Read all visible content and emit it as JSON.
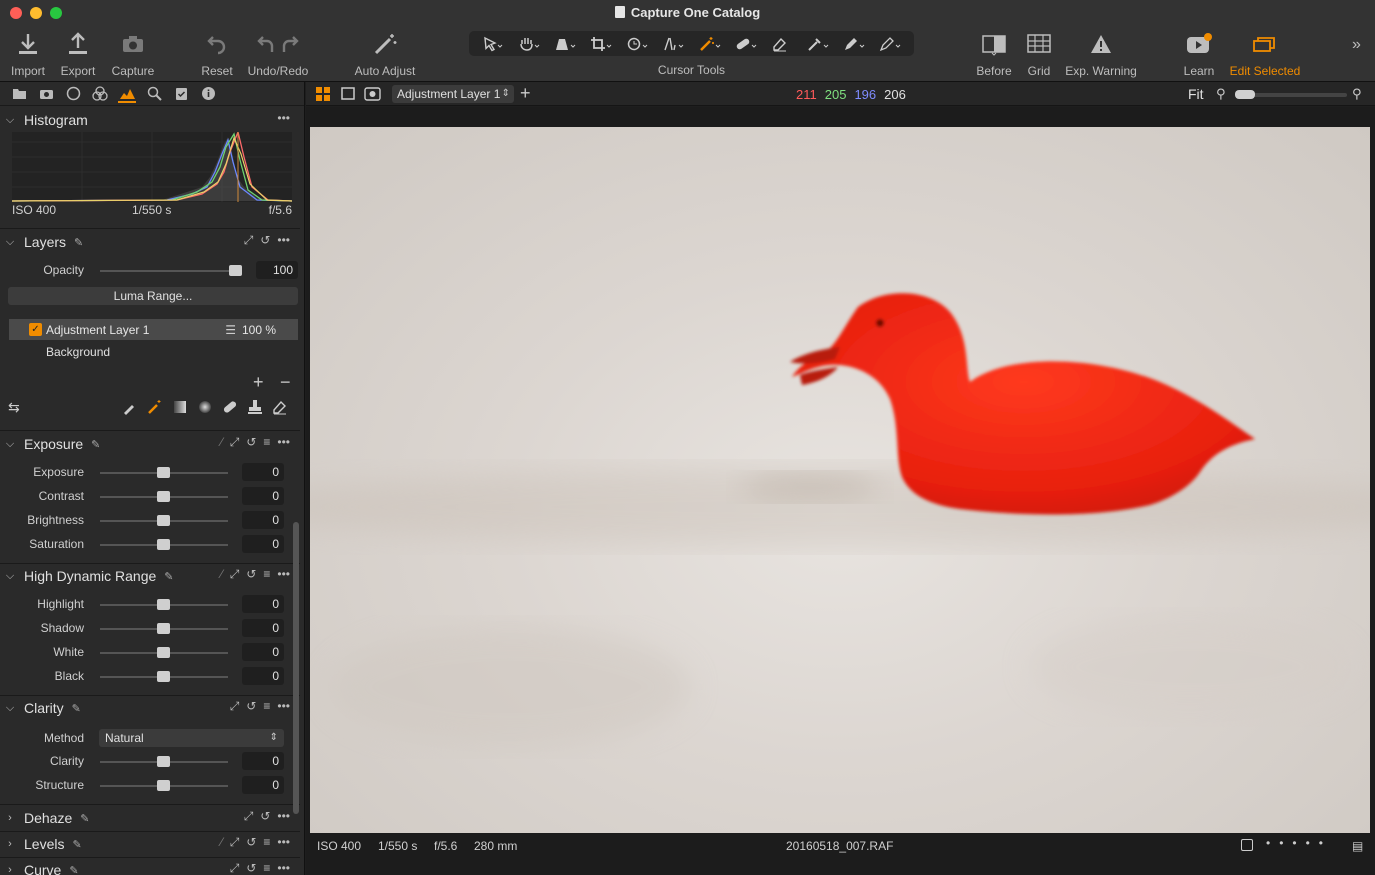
{
  "window": {
    "title": "Capture One Catalog"
  },
  "toolbar": {
    "import": "Import",
    "export": "Export",
    "capture": "Capture",
    "reset": "Reset",
    "undo_redo": "Undo/Redo",
    "auto_adjust": "Auto Adjust",
    "cursor_tools": "Cursor Tools",
    "before": "Before",
    "grid": "Grid",
    "exp_warning": "Exp. Warning",
    "learn": "Learn",
    "edit_selected": "Edit Selected"
  },
  "histogram": {
    "title": "Histogram",
    "iso": "ISO 400",
    "shutter": "1/550 s",
    "aperture": "f/5.6"
  },
  "layers": {
    "title": "Layers",
    "opacity_label": "Opacity",
    "opacity_value": "100",
    "opacity_level": 1.0,
    "luma_button": "Luma Range...",
    "items": [
      {
        "name": "Adjustment Layer 1",
        "percent": "100 %"
      },
      {
        "name": "Background"
      }
    ]
  },
  "exposure": {
    "title": "Exposure",
    "sliders": [
      {
        "label": "Exposure",
        "value": "0"
      },
      {
        "label": "Contrast",
        "value": "0"
      },
      {
        "label": "Brightness",
        "value": "0"
      },
      {
        "label": "Saturation",
        "value": "0"
      }
    ]
  },
  "hdr": {
    "title": "High Dynamic Range",
    "sliders": [
      {
        "label": "Highlight",
        "value": "0"
      },
      {
        "label": "Shadow",
        "value": "0"
      },
      {
        "label": "White",
        "value": "0"
      },
      {
        "label": "Black",
        "value": "0"
      }
    ]
  },
  "clarity": {
    "title": "Clarity",
    "method_label": "Method",
    "method_value": "Natural",
    "sliders": [
      {
        "label": "Clarity",
        "value": "0"
      },
      {
        "label": "Structure",
        "value": "0"
      }
    ]
  },
  "collapsed_sections": [
    "Dehaze",
    "Levels",
    "Curve"
  ],
  "viewer": {
    "layer_select": "Adjustment Layer 1",
    "rgb": {
      "r": "211",
      "g": "205",
      "b": "196",
      "l": "206"
    },
    "zoom": "Fit",
    "colors": {
      "r": "#ff5a5a",
      "g": "#7fe07f",
      "b": "#7f8cff"
    }
  },
  "status": {
    "iso": "ISO 400",
    "shutter": "1/550 s",
    "aperture": "f/5.6",
    "focal": "280 mm",
    "filename": "20160518_007.RAF"
  },
  "accent": "#f08c00"
}
